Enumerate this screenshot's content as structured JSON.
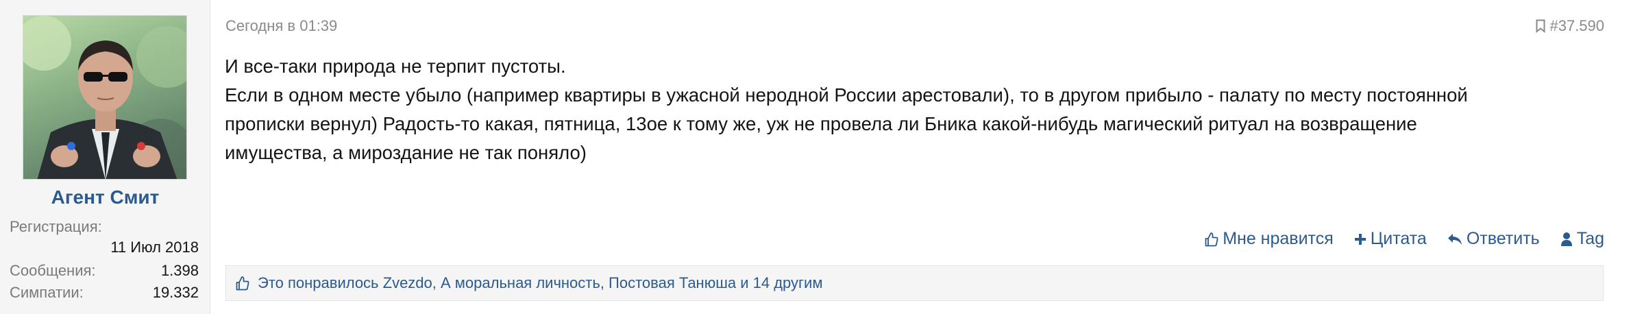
{
  "user": {
    "name": "Агент Смит",
    "registration_label": "Регистрация:",
    "registration_value": "11 Июл 2018",
    "messages_label": "Сообщения:",
    "messages_value": "1.398",
    "likes_label": "Симпатии:",
    "likes_value": "19.332"
  },
  "post": {
    "date": "Сегодня в 01:39",
    "number": "#37.590",
    "lines": [
      "И все-таки природа не терпит пустоты.",
      "Если в одном месте убыло (например квартиры в ужасной неродной России арестовали), то в другом прибыло - палату по месту постоянной",
      "прописки вернул) Радость-то какая, пятница, 13ое к тому же, уж не провела ли Бника какой-нибудь магический ритуал на возвращение",
      "имущества, а мироздание не так поняло)"
    ]
  },
  "actions": {
    "like": "Мне нравится",
    "quote": "Цитата",
    "reply": "Ответить",
    "tag": "Tag"
  },
  "likes_bar": {
    "text": "Это понравилось Zvezdo, А моральная личность, Постовая Танюша и 14 другим"
  },
  "colors": {
    "link": "#2b5a8e",
    "muted": "#8a8a8a",
    "sidebar_bg": "#f5f5f5"
  },
  "icons": {
    "bookmark": "bookmark-icon",
    "like": "thumbs-up-icon",
    "quote": "plus-icon",
    "reply": "reply-arrow-icon",
    "tag": "user-icon"
  }
}
